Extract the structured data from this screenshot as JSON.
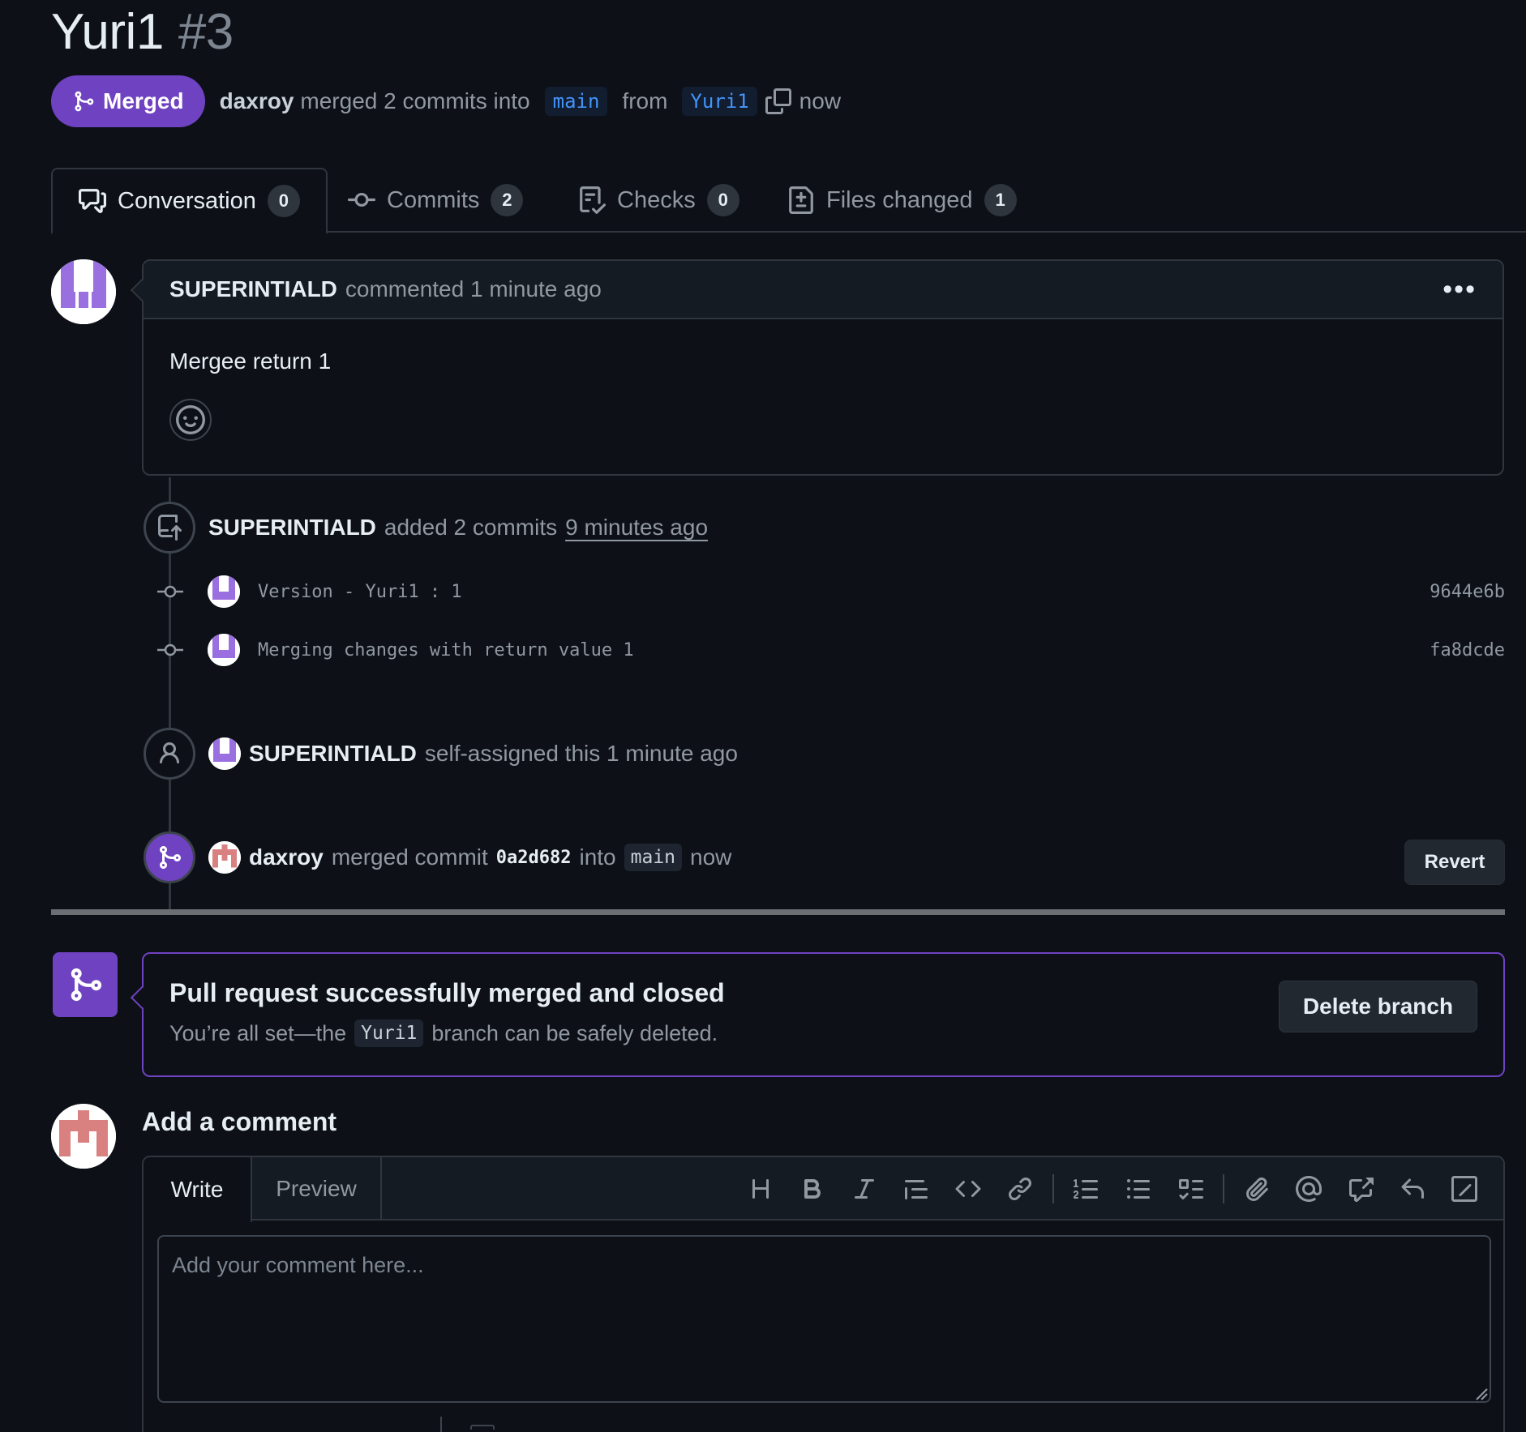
{
  "header": {
    "title": "Yuri1",
    "number": "#3",
    "state_label": "Merged",
    "merged_by": "daxroy",
    "merged_text": "merged 2 commits into",
    "base_branch": "main",
    "from_text": "from",
    "head_branch": "Yuri1",
    "when": "now"
  },
  "tabs": [
    {
      "label": "Conversation",
      "count": "0"
    },
    {
      "label": "Commits",
      "count": "2"
    },
    {
      "label": "Checks",
      "count": "0"
    },
    {
      "label": "Files changed",
      "count": "1"
    }
  ],
  "comment": {
    "author": "SUPERINTIALD",
    "action": "commented 1 minute ago",
    "body": "Mergee return 1"
  },
  "timeline": {
    "commits_event": {
      "author": "SUPERINTIALD",
      "action": "added 2 commits",
      "time": "9 minutes ago"
    },
    "commits": [
      {
        "message": "Version - Yuri1 : 1",
        "sha": "9644e6b"
      },
      {
        "message": "Merging changes with return value 1",
        "sha": "fa8dcde"
      }
    ],
    "assign_event": {
      "author": "SUPERINTIALD",
      "action": "self-assigned this 1 minute ago"
    },
    "merge_event": {
      "author": "daxroy",
      "action": "merged commit",
      "sha": "0a2d682",
      "into": "into",
      "branch": "main",
      "time": "now",
      "revert_label": "Revert"
    }
  },
  "merge_box": {
    "title": "Pull request successfully merged and closed",
    "sub_before": "You’re all set—the",
    "branch": "Yuri1",
    "sub_after": "branch can be safely deleted.",
    "delete_label": "Delete branch"
  },
  "composer": {
    "title": "Add a comment",
    "write_tab": "Write",
    "preview_tab": "Preview",
    "placeholder": "Add your comment here...",
    "toolbar": [
      "heading-icon",
      "bold-icon",
      "italic-icon",
      "quote-icon",
      "code-icon",
      "link-icon",
      "ordered-list-icon",
      "unordered-list-icon",
      "task-list-icon",
      "attach-icon",
      "mention-icon",
      "cross-reference-icon",
      "reply-icon",
      "slash-command-icon"
    ]
  },
  "colors": {
    "background": "#0d1117",
    "merged_purple": "#6f42c1",
    "border": "#30363d",
    "muted_text": "#9198a1",
    "link_blue": "#4493f8"
  }
}
